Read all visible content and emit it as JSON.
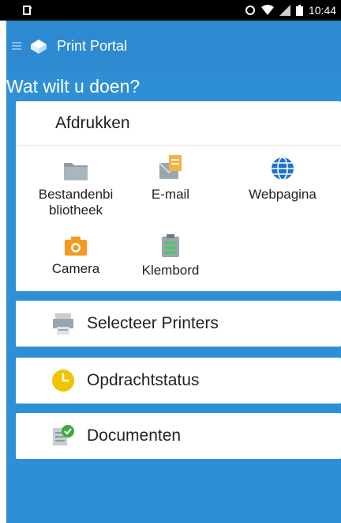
{
  "status_bar": {
    "time": "10:44",
    "icons": [
      "sync-icon",
      "wifi-icon",
      "signal-icon",
      "battery-icon"
    ]
  },
  "app_bar": {
    "title": "Print Portal",
    "icons": [
      "menu-icon",
      "print-portal-logo-icon"
    ]
  },
  "prompt": "Wat wilt u doen?",
  "print_section": {
    "title": "Afdrukken",
    "options": [
      {
        "label_line1": "Bestandenbi",
        "label_line2": "bliotheek",
        "icon": "folder-icon"
      },
      {
        "label_line1": "E-mail",
        "icon": "email-icon"
      },
      {
        "label_line1": "Webpagina",
        "icon": "globe-icon"
      },
      {
        "label_line1": "Camera",
        "icon": "camera-icon"
      },
      {
        "label_line1": "Klembord",
        "icon": "clipboard-icon"
      }
    ]
  },
  "menu_rows": [
    {
      "label": "Selecteer Printers",
      "icon": "printer-icon"
    },
    {
      "label": "Opdrachtstatus",
      "icon": "clock-icon"
    },
    {
      "label": "Documenten",
      "icon": "document-check-icon"
    }
  ],
  "colors": {
    "primary": "#2f8fd5",
    "status_bar": "#000000",
    "card": "#ffffff",
    "accent_orange": "#f39a1f",
    "accent_yellow": "#f2c300",
    "accent_green": "#3cab3c",
    "globe_blue": "#1f72c8"
  }
}
